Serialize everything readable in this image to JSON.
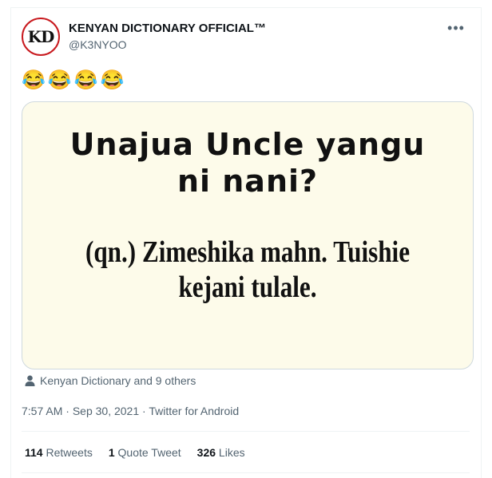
{
  "author": {
    "display_name": "KENYAN DICTIONARY OFFICIAL™",
    "handle": "@K3NYOO",
    "avatar_text": "KD"
  },
  "more_label": "•••",
  "tweet": {
    "text": "😂😂😂😂"
  },
  "media": {
    "title_line1": "Unajua Uncle yangu",
    "title_line2": "ni nani?",
    "sub_line1": "(qn.) Zimeshika mahn. Tuishie",
    "sub_line2": "kejani tulale.",
    "background_color": "#fdfbea"
  },
  "social_context": {
    "icon": "person-icon",
    "text": "Kenyan Dictionary and 9 others"
  },
  "timestamp": {
    "time": "7:57 AM",
    "separator1": " · ",
    "date": "Sep 30, 2021",
    "separator2": " · ",
    "source": "Twitter for Android"
  },
  "stats": {
    "retweets_count": "114",
    "retweets_label": "Retweets",
    "quotes_count": "1",
    "quotes_label": "Quote Tweet",
    "likes_count": "326",
    "likes_label": "Likes"
  }
}
